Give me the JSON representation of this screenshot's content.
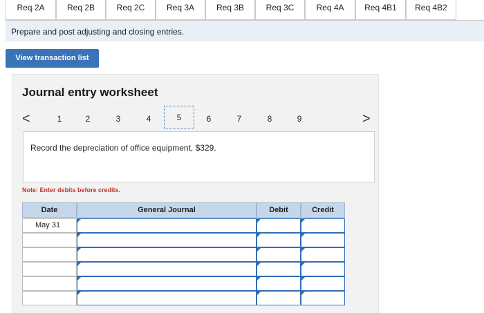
{
  "tabs": [
    "Req 2A",
    "Req 2B",
    "Req 2C",
    "Req 3A",
    "Req 3B",
    "Req 3C",
    "Req 4A",
    "Req 4B1",
    "Req 4B2"
  ],
  "instruction": "Prepare and post adjusting and closing entries.",
  "view_button": "View transaction list",
  "worksheet": {
    "title": "Journal entry worksheet",
    "prev": "<",
    "next": ">",
    "pages": [
      "1",
      "2",
      "3",
      "4",
      "5",
      "6",
      "7",
      "8",
      "9"
    ],
    "active_page": "5",
    "description": "Record the depreciation of office equipment, $329.",
    "note": "Note: Enter debits before credits."
  },
  "journal": {
    "headers": {
      "date": "Date",
      "general_journal": "General Journal",
      "debit": "Debit",
      "credit": "Credit"
    },
    "rows": [
      {
        "date": "May 31"
      },
      {
        "date": ""
      },
      {
        "date": ""
      },
      {
        "date": ""
      },
      {
        "date": ""
      },
      {
        "date": ""
      }
    ]
  },
  "colors": {
    "accent": "#3a73b8",
    "header_bg": "#c6d6ea",
    "instruction_bg": "#e8eff7",
    "note": "#c0392b"
  }
}
